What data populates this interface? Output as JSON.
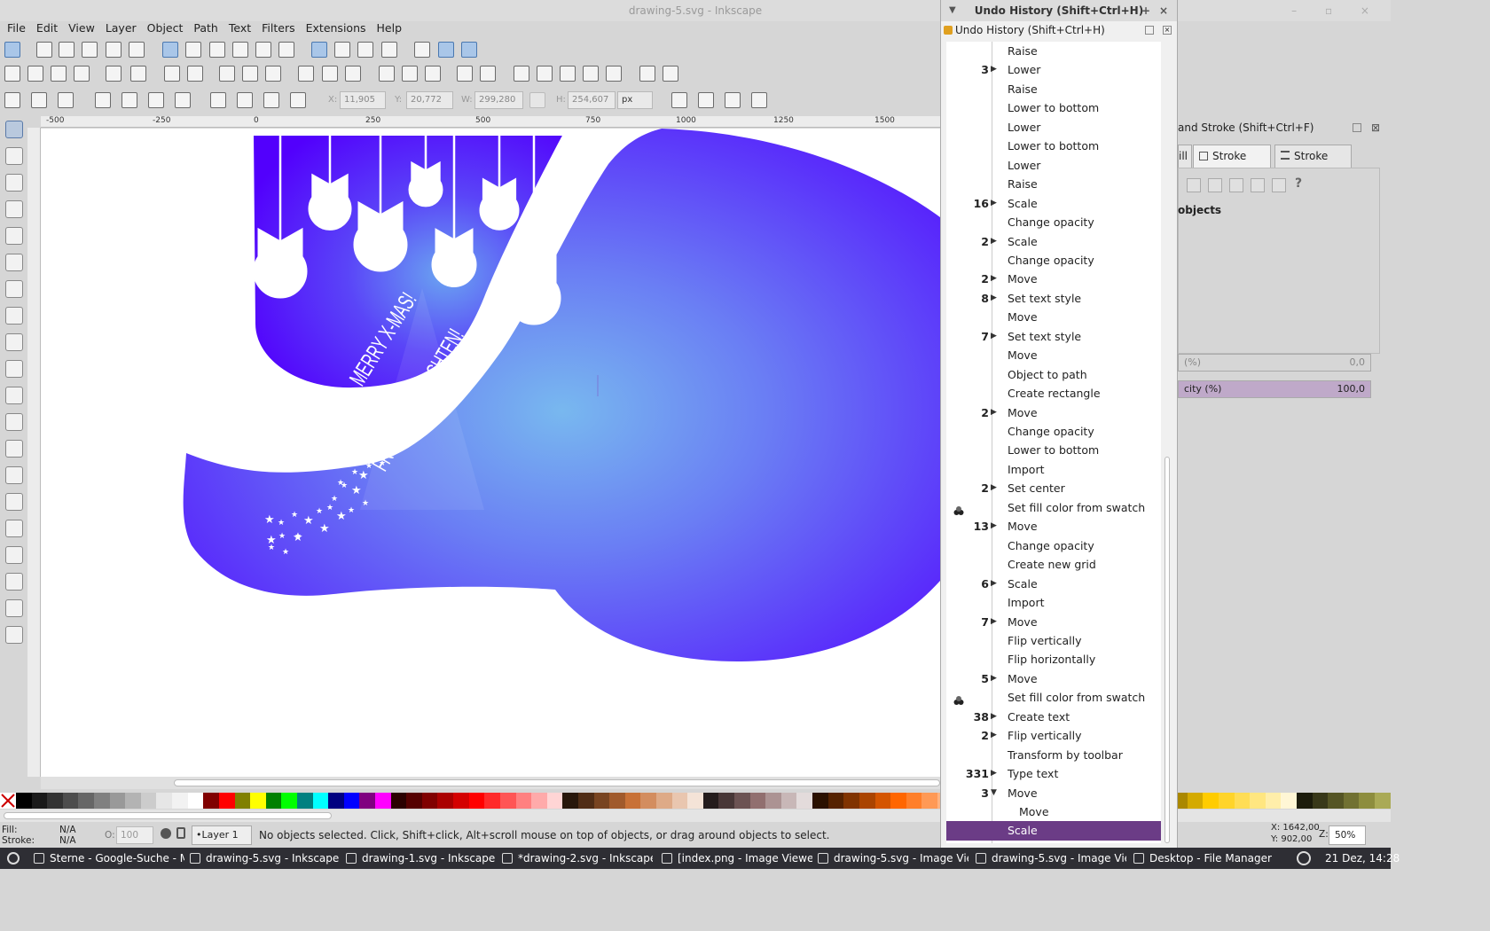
{
  "window": {
    "title": "drawing-5.svg - Inkscape"
  },
  "menu": [
    "File",
    "Edit",
    "View",
    "Layer",
    "Object",
    "Path",
    "Text",
    "Filters",
    "Extensions",
    "Help"
  ],
  "controls": {
    "x_label": "X:",
    "x_value": "11,905",
    "y_label": "Y:",
    "y_value": "20,772",
    "w_label": "W:",
    "w_value": "299,280",
    "h_label": "H:",
    "h_value": "254,607",
    "unit": "px"
  },
  "ruler": {
    "h_ticks": [
      "-500",
      "-250",
      "0",
      "250",
      "500",
      "750",
      "1000",
      "1250",
      "1500"
    ],
    "v_ticks": [
      "1 0 0",
      "7 5",
      "5 0",
      "2 5 0",
      "2 5",
      "5 0",
      "2 5 0"
    ]
  },
  "canvas": {
    "text_merry": "MERRY X-MAS!",
    "text_frohe": "FROHE WEIHNACHTEN!",
    "colors": {
      "deep": "#5200fc",
      "mid": "#6a4ef6",
      "light": "#74b6ef"
    }
  },
  "undo_dialog": {
    "window_title": "Undo History (Shift+Ctrl+H)",
    "panel_title": "Undo History (Shift+Ctrl+H)",
    "items": [
      {
        "count": "",
        "expander": "",
        "label": "Raise",
        "icon": ""
      },
      {
        "count": "3",
        "expander": "▶",
        "label": "Lower",
        "icon": ""
      },
      {
        "count": "",
        "expander": "",
        "label": "Raise",
        "icon": ""
      },
      {
        "count": "",
        "expander": "",
        "label": "Lower to bottom",
        "icon": ""
      },
      {
        "count": "",
        "expander": "",
        "label": "Lower",
        "icon": ""
      },
      {
        "count": "",
        "expander": "",
        "label": "Lower to bottom",
        "icon": ""
      },
      {
        "count": "",
        "expander": "",
        "label": "Lower",
        "icon": ""
      },
      {
        "count": "",
        "expander": "",
        "label": "Raise",
        "icon": ""
      },
      {
        "count": "16",
        "expander": "▶",
        "label": "Scale",
        "icon": ""
      },
      {
        "count": "",
        "expander": "",
        "label": "Change opacity",
        "icon": ""
      },
      {
        "count": "2",
        "expander": "▶",
        "label": "Scale",
        "icon": ""
      },
      {
        "count": "",
        "expander": "",
        "label": "Change opacity",
        "icon": ""
      },
      {
        "count": "2",
        "expander": "▶",
        "label": "Move",
        "icon": ""
      },
      {
        "count": "8",
        "expander": "▶",
        "label": "Set text style",
        "icon": ""
      },
      {
        "count": "",
        "expander": "",
        "label": "Move",
        "icon": ""
      },
      {
        "count": "7",
        "expander": "▶",
        "label": "Set text style",
        "icon": ""
      },
      {
        "count": "",
        "expander": "",
        "label": "Move",
        "icon": ""
      },
      {
        "count": "",
        "expander": "",
        "label": "Object to path",
        "icon": ""
      },
      {
        "count": "",
        "expander": "",
        "label": "Create rectangle",
        "icon": ""
      },
      {
        "count": "2",
        "expander": "▶",
        "label": "Move",
        "icon": ""
      },
      {
        "count": "",
        "expander": "",
        "label": "Change opacity",
        "icon": ""
      },
      {
        "count": "",
        "expander": "",
        "label": "Lower to bottom",
        "icon": ""
      },
      {
        "count": "",
        "expander": "",
        "label": "Import",
        "icon": ""
      },
      {
        "count": "2",
        "expander": "▶",
        "label": "Set center",
        "icon": ""
      },
      {
        "count": "",
        "expander": "",
        "label": "Set fill color from swatch",
        "icon": "swatch-icon"
      },
      {
        "count": "13",
        "expander": "▶",
        "label": "Move",
        "icon": ""
      },
      {
        "count": "",
        "expander": "",
        "label": "Change opacity",
        "icon": ""
      },
      {
        "count": "",
        "expander": "",
        "label": "Create new grid",
        "icon": ""
      },
      {
        "count": "6",
        "expander": "▶",
        "label": "Scale",
        "icon": ""
      },
      {
        "count": "",
        "expander": "",
        "label": "Import",
        "icon": ""
      },
      {
        "count": "7",
        "expander": "▶",
        "label": "Move",
        "icon": ""
      },
      {
        "count": "",
        "expander": "",
        "label": "Flip vertically",
        "icon": ""
      },
      {
        "count": "",
        "expander": "",
        "label": "Flip horizontally",
        "icon": ""
      },
      {
        "count": "5",
        "expander": "▶",
        "label": "Move",
        "icon": ""
      },
      {
        "count": "",
        "expander": "",
        "label": "Set fill color from swatch",
        "icon": "swatch-icon"
      },
      {
        "count": "38",
        "expander": "▶",
        "label": "Create text",
        "icon": ""
      },
      {
        "count": "2",
        "expander": "▶",
        "label": "Flip vertically",
        "icon": ""
      },
      {
        "count": "",
        "expander": "",
        "label": "Transform by toolbar",
        "icon": ""
      },
      {
        "count": "331",
        "expander": "▶",
        "label": "Type text",
        "icon": ""
      },
      {
        "count": "3",
        "expander": "▼",
        "label": "Move",
        "icon": ""
      },
      {
        "count": "",
        "expander": "",
        "label": "Move",
        "icon": "",
        "child": true
      },
      {
        "count": "",
        "expander": "",
        "label": "Scale",
        "icon": "",
        "selected": true
      }
    ]
  },
  "fill_stroke": {
    "title": "and Stroke (Shift+Ctrl+F)",
    "tab_fill": "ill",
    "tab_stroke_paint": "Stroke paint",
    "tab_stroke_style": "Stroke style",
    "no_objects": "objects",
    "blur_label": "(%)",
    "blur_value": "0,0",
    "opacity_label": "city (%)",
    "opacity_value": "100,0"
  },
  "status": {
    "fill_label": "Fill:",
    "fill_value": "N/A",
    "stroke_label": "Stroke:",
    "stroke_value": "N/A",
    "o_label": "O:",
    "o_value": "100",
    "layer": "•Layer 1",
    "message": "No objects selected. Click, Shift+click, Alt+scroll mouse on top of objects, or drag around objects to select.",
    "x_coord": "X: 1642,00",
    "y_coord": "Y:  902,00",
    "zoom_label": "Z:",
    "zoom_value": "50%"
  },
  "taskbar": {
    "items": [
      "Sterne - Google-Suche - M...",
      "drawing-5.svg - Inkscape",
      "drawing-1.svg - Inkscape",
      "*drawing-2.svg - Inkscape",
      "[index.png - Image Viewer ...",
      "drawing-5.svg - Image Vie...",
      "drawing-5.svg - Image Vie...",
      "Desktop - File Manager"
    ],
    "clock": "21 Dez, 14:28"
  },
  "palette": [
    "#000000",
    "#1a1a1a",
    "#333333",
    "#4d4d4d",
    "#666666",
    "#808080",
    "#999999",
    "#b3b3b3",
    "#cccccc",
    "#e6e6e6",
    "#f2f2f2",
    "#ffffff",
    "#800000",
    "#ff0000",
    "#808000",
    "#ffff00",
    "#008000",
    "#00ff00",
    "#008080",
    "#00ffff",
    "#000080",
    "#0000ff",
    "#800080",
    "#ff00ff",
    "#2b0000",
    "#550000",
    "#800000",
    "#aa0000",
    "#d40000",
    "#ff0000",
    "#ff2a2a",
    "#ff5555",
    "#ff8080",
    "#ffaaaa",
    "#ffd5d5",
    "#28170b",
    "#502d16",
    "#784421",
    "#a05a2c",
    "#c87137",
    "#d38d5f",
    "#deaa87",
    "#e9c6af",
    "#f4e3d7",
    "#241c1c",
    "#483737",
    "#6c5353",
    "#916f6f",
    "#ac9393",
    "#c8b7b7",
    "#e3dbdb",
    "#2b1100",
    "#552200",
    "#803300",
    "#aa4400",
    "#d45500",
    "#ff6600",
    "#ff7f2a",
    "#ff9955",
    "#ffb380",
    "#ffccaa",
    "#ffe6d5",
    "#28220b",
    "#504416",
    "#786721",
    "#a0892c",
    "#c8ab37",
    "#d3bc5f",
    "#decd87",
    "#e9ddaf",
    "#f4eed7",
    "#2b2200",
    "#554400",
    "#806600",
    "#aa8800",
    "#d4aa00",
    "#ffcc00",
    "#ffd42a",
    "#ffdd55",
    "#ffe680",
    "#ffeeaa",
    "#fff6d5",
    "#1c1c0c",
    "#383819",
    "#555525",
    "#717132",
    "#8d8d3e",
    "#aaaa56"
  ]
}
